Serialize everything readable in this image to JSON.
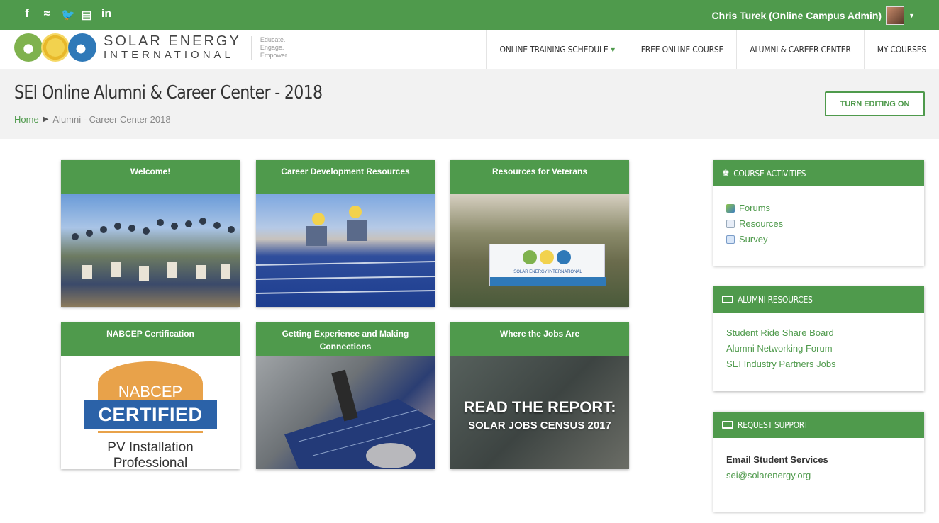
{
  "topbar": {
    "social": [
      "f",
      "≈",
      "ὂ6",
      "▤",
      "in"
    ],
    "social_names": [
      "facebook",
      "rss",
      "twitter",
      "youtube",
      "linkedin"
    ],
    "user_name": "Chris Turek (Online Campus Admin)"
  },
  "brand": {
    "line1": "SOLAR ENERGY",
    "line2": "INTERNATIONAL",
    "tagline": [
      "Educate.",
      "Engage.",
      "Empower."
    ]
  },
  "nav": {
    "items": [
      "ONLINE TRAINING SCHEDULE",
      "FREE ONLINE COURSE",
      "ALUMNI & CAREER CENTER",
      "MY COURSES"
    ]
  },
  "header": {
    "title": "SEI Online Alumni & Career Center - 2018",
    "breadcrumb_home": "Home",
    "breadcrumb_sep": "▶",
    "breadcrumb_current": "Alumni - Career Center 2018",
    "edit_button": "TURN EDITING ON"
  },
  "tiles": [
    {
      "title": "Welcome!"
    },
    {
      "title": "Career Development Resources"
    },
    {
      "title": "Resources for Veterans"
    },
    {
      "title": "NABCEP Certification"
    },
    {
      "title": "Getting Experience and Making Connections"
    },
    {
      "title": "Where the Jobs Are"
    }
  ],
  "nabcep": {
    "seal": "NABCEP",
    "certified": "CERTIFIED",
    "line1": "PV Installation",
    "line2": "Professional"
  },
  "report": {
    "line1": "READ THE REPORT:",
    "line2": "SOLAR JOBS CENSUS 2017"
  },
  "veterans_banner": "SOLAR ENERGY INTERNATIONAL",
  "blocks": {
    "activities": {
      "title": "COURSE ACTIVITIES",
      "items": [
        "Forums",
        "Resources",
        "Survey"
      ]
    },
    "alumni": {
      "title": "ALUMNI RESOURCES",
      "items": [
        "Student Ride Share Board",
        "Alumni Networking Forum",
        "SEI Industry Partners Jobs"
      ]
    },
    "support": {
      "title": "REQUEST SUPPORT",
      "email_label": "Email Student Services",
      "email": "sei@solarenergy.org"
    }
  },
  "colors": {
    "brand_green": "#4f9a4c",
    "nabcep_orange": "#e8a24a",
    "nabcep_blue": "#2b62a8"
  }
}
